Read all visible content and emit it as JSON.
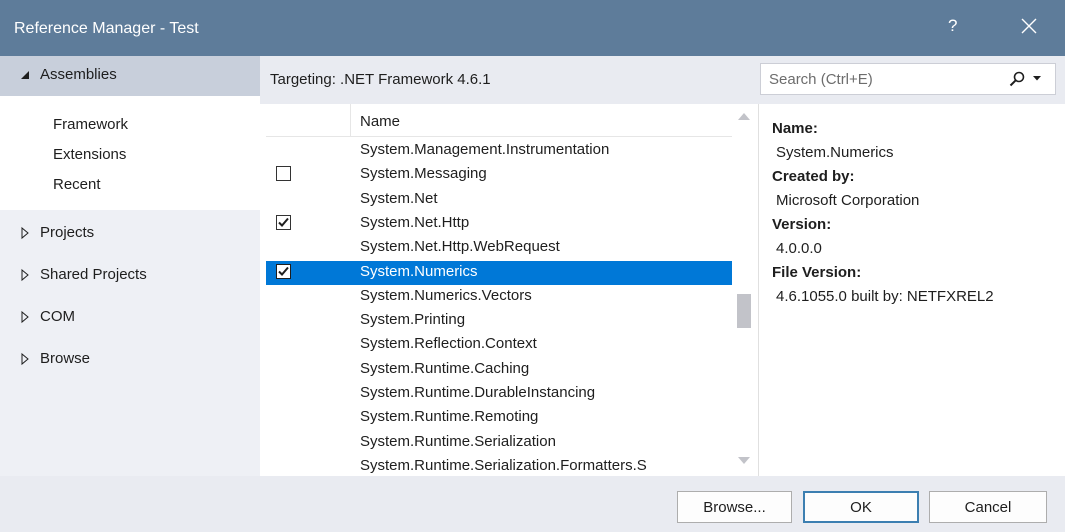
{
  "window": {
    "title": "Reference Manager - Test",
    "help_label": "?"
  },
  "nav": {
    "assemblies": {
      "label": "Assemblies",
      "expanded": true,
      "children": [
        "Framework",
        "Extensions",
        "Recent"
      ]
    },
    "projects": "Projects",
    "shared_projects": "Shared Projects",
    "com": "COM",
    "browse": "Browse"
  },
  "targeting": "Targeting: .NET Framework 4.6.1",
  "search": {
    "placeholder": "Search (Ctrl+E)"
  },
  "list": {
    "column_name": "Name",
    "rows": [
      {
        "name": "System.Management.Instrumentation",
        "checkbox": false,
        "checked": false,
        "selected": false
      },
      {
        "name": "System.Messaging",
        "checkbox": true,
        "checked": false,
        "selected": false
      },
      {
        "name": "System.Net",
        "checkbox": false,
        "checked": false,
        "selected": false
      },
      {
        "name": "System.Net.Http",
        "checkbox": true,
        "checked": true,
        "selected": false
      },
      {
        "name": "System.Net.Http.WebRequest",
        "checkbox": false,
        "checked": false,
        "selected": false
      },
      {
        "name": "System.Numerics",
        "checkbox": true,
        "checked": true,
        "selected": true
      },
      {
        "name": "System.Numerics.Vectors",
        "checkbox": false,
        "checked": false,
        "selected": false
      },
      {
        "name": "System.Printing",
        "checkbox": false,
        "checked": false,
        "selected": false
      },
      {
        "name": "System.Reflection.Context",
        "checkbox": false,
        "checked": false,
        "selected": false
      },
      {
        "name": "System.Runtime.Caching",
        "checkbox": false,
        "checked": false,
        "selected": false
      },
      {
        "name": "System.Runtime.DurableInstancing",
        "checkbox": false,
        "checked": false,
        "selected": false
      },
      {
        "name": "System.Runtime.Remoting",
        "checkbox": false,
        "checked": false,
        "selected": false
      },
      {
        "name": "System.Runtime.Serialization",
        "checkbox": false,
        "checked": false,
        "selected": false
      },
      {
        "name": "System.Runtime.Serialization.Formatters.S",
        "checkbox": false,
        "checked": false,
        "selected": false
      }
    ]
  },
  "details": {
    "name_label": "Name:",
    "name_value": "System.Numerics",
    "created_label": "Created by:",
    "created_value": "Microsoft Corporation",
    "version_label": "Version:",
    "version_value": "4.0.0.0",
    "file_version_label": "File Version:",
    "file_version_value": "4.6.1055.0 built by: NETFXREL2"
  },
  "buttons": {
    "browse": "Browse...",
    "ok": "OK",
    "cancel": "Cancel"
  },
  "colors": {
    "titlebar": "#5e7c9a",
    "selection": "#0078d7",
    "nav_selected": "#c8cfdb",
    "chrome": "#e9ebf1"
  }
}
